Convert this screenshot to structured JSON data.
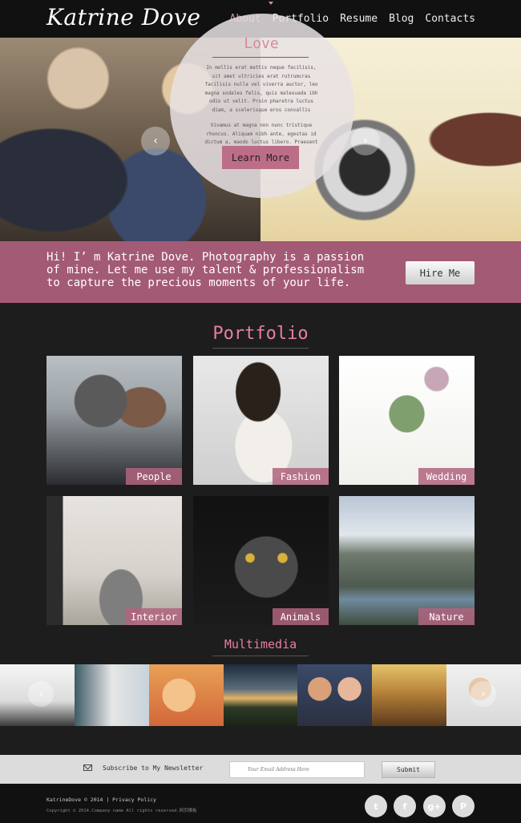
{
  "brand": "Katrine Dove",
  "nav": {
    "items": [
      {
        "label": "About",
        "active": true
      },
      {
        "label": "Portfolio",
        "active": false
      },
      {
        "label": "Resume",
        "active": false
      },
      {
        "label": "Blog",
        "active": false
      },
      {
        "label": "Contacts",
        "active": false
      }
    ]
  },
  "hero": {
    "title": "Love",
    "paragraph1": "In mollis erat mattis neque facilisis, sit amet ultricies erat rutrumcras facilisis nulla vel viverra auctor, leo magna sodales felis, quis malesuada ibh odio ut velit. Proin pharetra luctus diam, a scelerisque eros convallis",
    "paragraph2": "Vivamus at magna non nunc tristique rhoncus. Aliquam nibh ante, egestas id dictum a, maodo luctus libero. Praesent faucibus malesu",
    "cta": "Learn More",
    "arrow_prev": "‹",
    "arrow_next": "›"
  },
  "intro": {
    "text": "Hi! I’ m Katrine Dove. Photography is a passion of mine. Let me use my talent & professionalism to capture the precious moments of your life.",
    "cta": "Hire Me"
  },
  "portfolio": {
    "title": "Portfolio",
    "tiles": [
      {
        "label": "People"
      },
      {
        "label": "Fashion"
      },
      {
        "label": "Wedding"
      },
      {
        "label": "Interior"
      },
      {
        "label": "Animals"
      },
      {
        "label": "Nature"
      }
    ]
  },
  "multimedia": {
    "title": "Multimedia",
    "arrow_prev": "‹",
    "arrow_next": "›"
  },
  "newsletter": {
    "label": "Subscribe to My Newsletter",
    "placeholder": "Your Email Address Here",
    "submit": "Submit"
  },
  "footer": {
    "line1": "KatrineDove © 2014 | Privacy Policy",
    "line2": "Copyright © 2014.Company name All rights reserved.网页模板",
    "social": [
      {
        "icon": "twitter-icon",
        "glyph": "t"
      },
      {
        "icon": "facebook-icon",
        "glyph": "f"
      },
      {
        "icon": "google-plus-icon",
        "glyph": "g+"
      },
      {
        "icon": "pinterest-icon",
        "glyph": "P"
      }
    ]
  },
  "colors": {
    "accent": "#d08fa6",
    "band": "#a35a75",
    "background": "#1d1d1d"
  }
}
